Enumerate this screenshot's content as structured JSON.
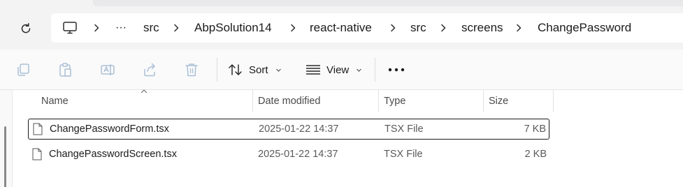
{
  "address": {
    "breadcrumbs": [
      "src",
      "AbpSolution14",
      "react-native",
      "src",
      "screens",
      "ChangePassword"
    ],
    "overflow_label": "···"
  },
  "toolbar": {
    "sort_label": "Sort",
    "view_label": "View",
    "more_label": "•••"
  },
  "columns": {
    "name": "Name",
    "date": "Date modified",
    "type": "Type",
    "size": "Size"
  },
  "files": [
    {
      "name": "ChangePasswordForm.tsx",
      "date": "2025-01-22 14:37",
      "type": "TSX File",
      "size": "7 KB",
      "selected": true
    },
    {
      "name": "ChangePasswordScreen.tsx",
      "date": "2025-01-22 14:37",
      "type": "TSX File",
      "size": "2 KB",
      "selected": false
    }
  ],
  "icons": {
    "refresh": "refresh-icon",
    "computer": "computer-icon",
    "copy": "copy-icon",
    "paste": "paste-icon",
    "rename": "rename-icon",
    "share": "share-icon",
    "delete": "delete-icon",
    "sort": "sort-icon",
    "view": "view-icon",
    "file": "file-icon"
  }
}
